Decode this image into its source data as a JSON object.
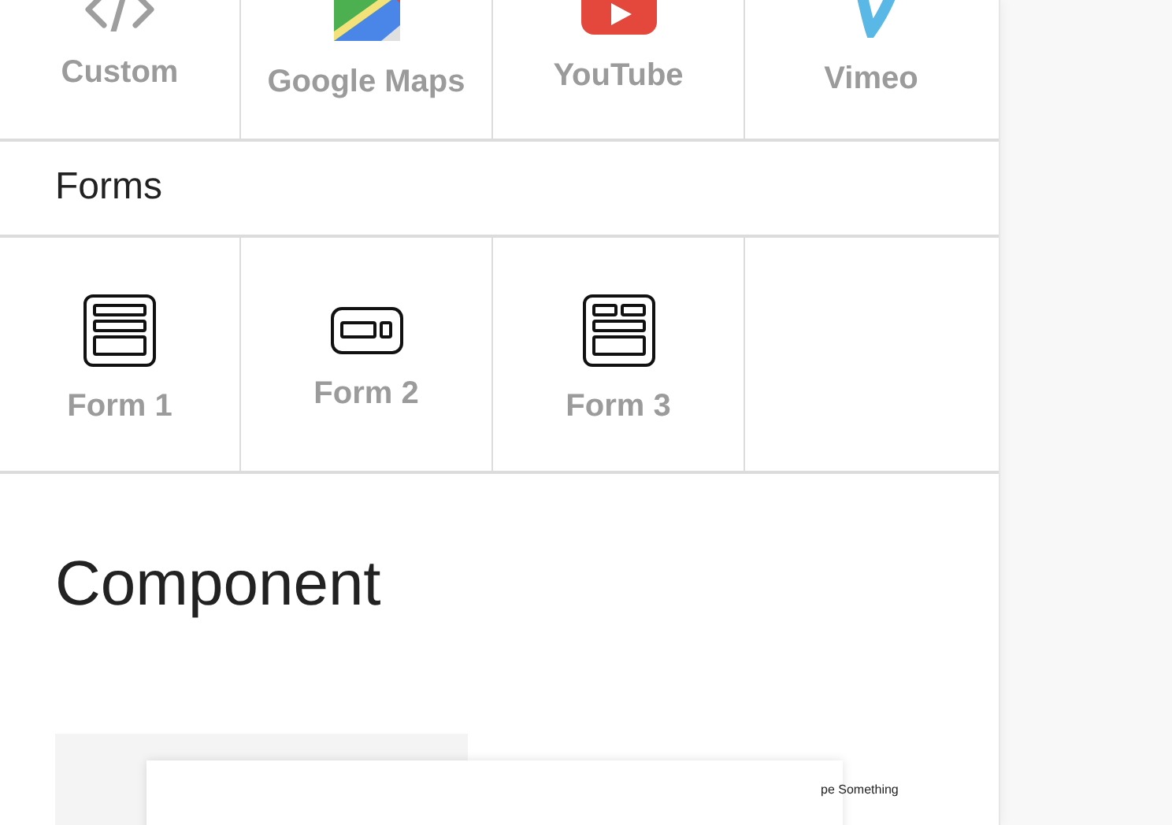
{
  "embeds": [
    {
      "label": "Custom",
      "kind": "code"
    },
    {
      "label": "Google Maps",
      "kind": "maps"
    },
    {
      "label": "YouTube",
      "kind": "youtube"
    },
    {
      "label": "Vimeo",
      "kind": "vimeo"
    }
  ],
  "forms_section": {
    "title": "Forms",
    "items": [
      {
        "label": "Form 1",
        "kind": "stacked"
      },
      {
        "label": "Form 2",
        "kind": "inline"
      },
      {
        "label": "Form 3",
        "kind": "grid"
      }
    ]
  },
  "component_section": {
    "title": "Component",
    "preview_text": "pe Something"
  }
}
